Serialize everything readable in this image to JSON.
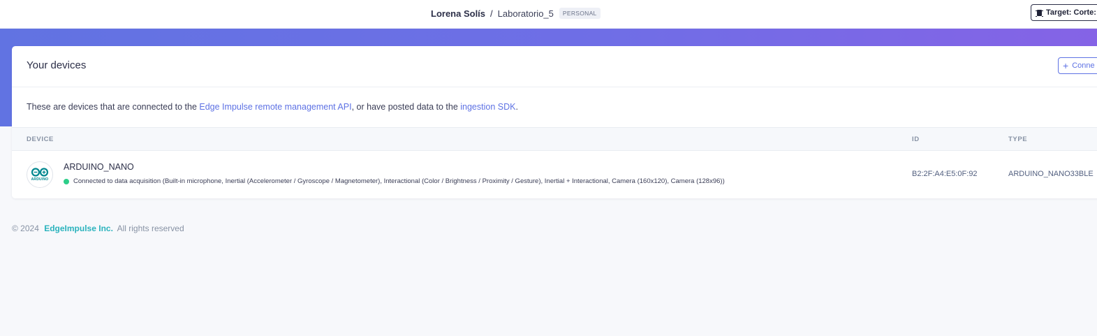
{
  "header": {
    "owner": "Lorena Solís",
    "separator": "/",
    "project": "Laboratorio_5",
    "badge": "PERSONAL",
    "target_button": "Target: Corte:"
  },
  "colors": {
    "accent": "#5e72e4",
    "banner_start": "#6173e2",
    "banner_end": "#8563e6",
    "status_connected": "#2dce89",
    "footer_link": "#2bb3bd"
  },
  "devices_card": {
    "title": "Your devices",
    "connect_button": "Conne",
    "description": {
      "prefix": "These are devices that are connected to the ",
      "link1": "Edge Impulse remote management API",
      "middle": ", or have posted data to the ",
      "link2": "ingestion SDK",
      "suffix": "."
    },
    "table": {
      "columns": [
        "DEVICE",
        "ID",
        "TYPE"
      ],
      "rows": [
        {
          "icon": "arduino-logo",
          "logo_text": "ARDUINO",
          "name": "ARDUINO_NANO",
          "status": "Connected to data acquisition (Built-in microphone, Inertial (Accelerometer / Gyroscope / Magnetometer), Interactional (Color / Brightness / Proximity / Gesture), Inertial + Interactional, Camera (160x120), Camera (128x96))",
          "id": "B2:2F:A4:E5:0F:92",
          "type": "ARDUINO_NANO33BLE"
        }
      ]
    }
  },
  "footer": {
    "copyright": "© 2024",
    "company": "EdgeImpulse Inc.",
    "rights": "All rights reserved"
  }
}
